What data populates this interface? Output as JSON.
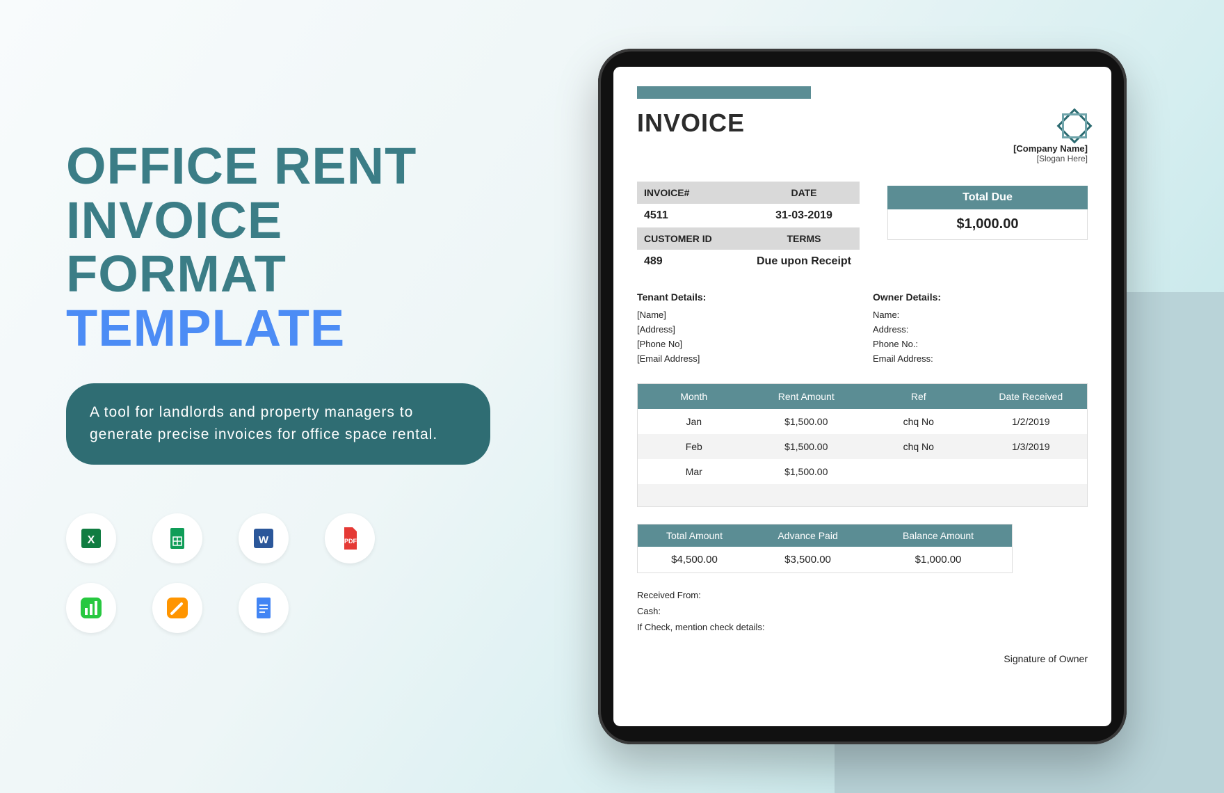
{
  "title": {
    "line1": "OFFICE RENT",
    "line2": "INVOICE",
    "line3": "FORMAT",
    "line4": "TEMPLATE"
  },
  "description": "A tool for landlords and property managers to generate precise invoices for office space rental.",
  "formats": [
    "Excel",
    "Google Sheets",
    "Word",
    "PDF",
    "Apple Numbers",
    "Apple Pages",
    "Google Docs"
  ],
  "invoice": {
    "doc_title": "INVOICE",
    "company_name": "[Company Name]",
    "slogan": "[Slogan Here]",
    "labels": {
      "invoice_no": "INVOICE#",
      "date": "DATE",
      "customer_id": "CUSTOMER ID",
      "terms": "TERMS",
      "total_due": "Total Due"
    },
    "invoice_no": "4511",
    "date": "31-03-2019",
    "customer_id": "489",
    "terms": "Due upon Receipt",
    "total_due": "$1,000.00",
    "tenant": {
      "title": "Tenant Details:",
      "name": "[Name]",
      "address": "[Address]",
      "phone": "[Phone No]",
      "email": "[Email Address]"
    },
    "owner": {
      "title": "Owner Details:",
      "name": "Name:",
      "address": "Address:",
      "phone": "Phone No.:",
      "email": "Email Address:"
    },
    "columns": {
      "month": "Month",
      "rent": "Rent Amount",
      "ref": "Ref",
      "date_received": "Date Received"
    },
    "rows": [
      {
        "month": "Jan",
        "rent": "$1,500.00",
        "ref": "chq No",
        "date": "1/2/2019"
      },
      {
        "month": "Feb",
        "rent": "$1,500.00",
        "ref": "chq No",
        "date": "1/3/2019"
      },
      {
        "month": "Mar",
        "rent": "$1,500.00",
        "ref": "",
        "date": ""
      }
    ],
    "totals": {
      "total_amount_label": "Total Amount",
      "total_amount": "$4,500.00",
      "advance_paid_label": "Advance Paid",
      "advance_paid": "$3,500.00",
      "balance_label": "Balance Amount",
      "balance": "$1,000.00"
    },
    "footer": {
      "received_from": "Received From:",
      "cash": "Cash:",
      "check_note": "If Check, mention check details:",
      "signature": "Signature of Owner"
    }
  }
}
